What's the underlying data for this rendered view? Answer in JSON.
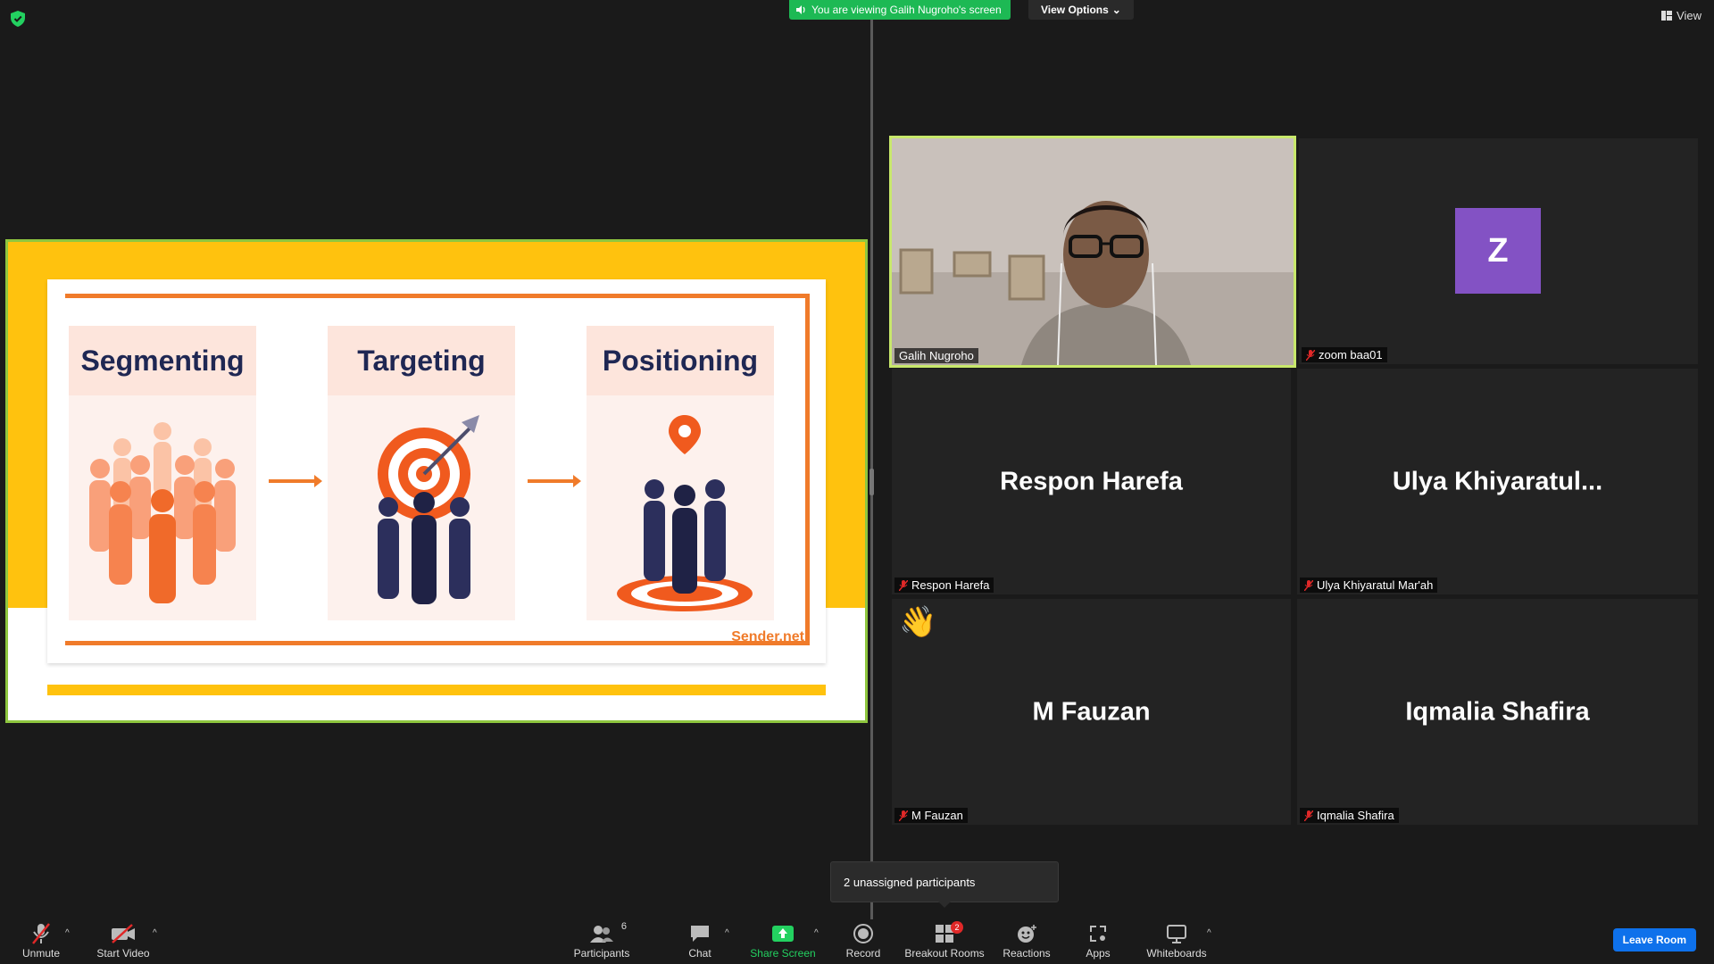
{
  "banner": {
    "text": "You are viewing Galih Nugroho's screen",
    "view_options": "View Options"
  },
  "top_right": {
    "view_label": "View"
  },
  "slide": {
    "columns": [
      "Segmenting",
      "Targeting",
      "Positioning"
    ],
    "brand": "Sender.net"
  },
  "tiles": [
    {
      "name": "Galih Nugroho",
      "type": "video",
      "active": true
    },
    {
      "name": "zoom baa01",
      "avatar": "Z",
      "muted": true
    },
    {
      "name": "Respon Harefa",
      "display": "Respon Harefa",
      "muted": true
    },
    {
      "name": "Ulya Khiyaratul Mar'ah",
      "display": "Ulya  Khiyaratul...",
      "muted": true
    },
    {
      "name": "M Fauzan",
      "display": "M Fauzan",
      "muted": true,
      "reaction": "👋"
    },
    {
      "name": "Iqmalia Shafira",
      "display": "Iqmalia Shafira",
      "muted": true
    }
  ],
  "tooltip": "2 unassigned participants",
  "toolbar": {
    "unmute": "Unmute",
    "start_video": "Start Video",
    "participants": "Participants",
    "participants_count": "6",
    "chat": "Chat",
    "share_screen": "Share Screen",
    "record": "Record",
    "breakout_rooms": "Breakout Rooms",
    "breakout_badge": "2",
    "reactions": "Reactions",
    "apps": "Apps",
    "whiteboards": "Whiteboards",
    "leave": "Leave Room"
  },
  "colors": {
    "accent_green": "#1db954",
    "active_border": "#c8e86b",
    "leave_blue": "#0e71eb",
    "mute_red": "#e02828",
    "slide_orange": "#f07b2a",
    "slide_yellow": "#ffc20e",
    "avatar_purple": "#8352c4"
  }
}
